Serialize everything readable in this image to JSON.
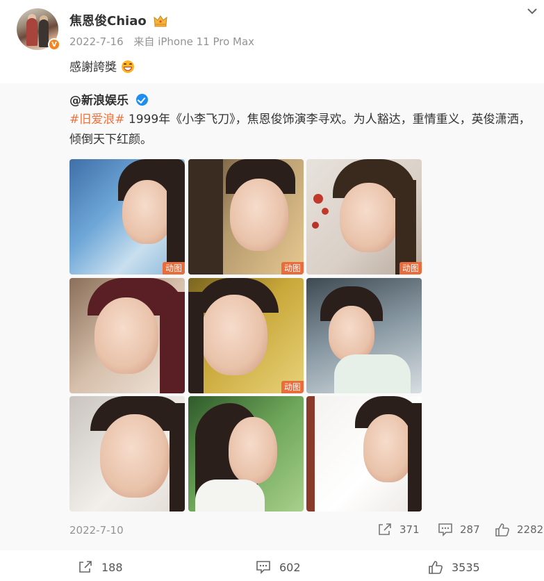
{
  "post": {
    "username": "焦恩俊Chiao",
    "date": "2022-7-16",
    "source": "来自 iPhone 11 Pro Max",
    "text": "感謝誇獎",
    "crown_icon": "crown-icon",
    "emoji": "grin-emoji"
  },
  "repost": {
    "author": "@新浪娱乐",
    "topic": "#旧爱浪#",
    "text": " 1999年《小李飞刀》，焦恩俊饰演李寻欢。为人豁达，重情重义，英俊潇洒，倾倒天下红颜。",
    "images": [
      {
        "badge": "动图"
      },
      {
        "badge": "动图"
      },
      {
        "badge": "动图"
      },
      {
        "badge": ""
      },
      {
        "badge": "动图"
      },
      {
        "badge": ""
      },
      {
        "badge": ""
      },
      {
        "badge": ""
      },
      {
        "badge": ""
      }
    ],
    "date": "2022-7-10",
    "stats": {
      "reposts": "371",
      "comments": "287",
      "likes": "2282"
    }
  },
  "footer": {
    "reposts": "188",
    "comments": "602",
    "likes": "3535"
  },
  "colors": {
    "accent": "#eb7340",
    "verified_orange": "#f7841d",
    "verified_blue": "#1e8ef0",
    "badge": "#e86c3c"
  }
}
